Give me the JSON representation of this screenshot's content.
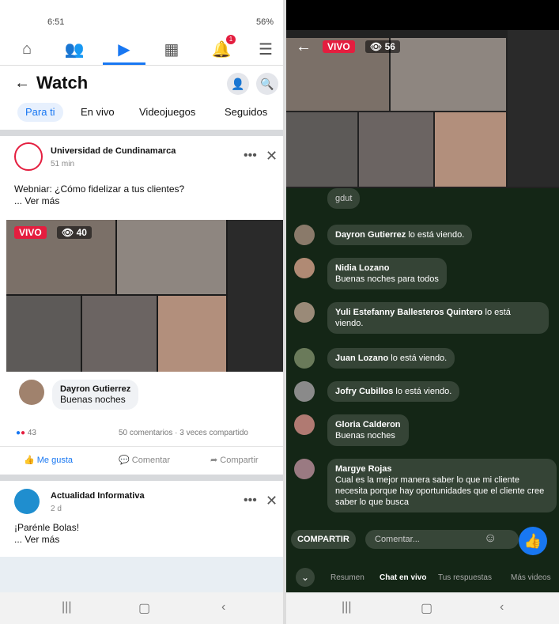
{
  "left": {
    "status": {
      "time": "6:51",
      "right": "56%"
    },
    "nav": {
      "icons": [
        "home-icon",
        "friends-icon",
        "watch-icon",
        "marketplace-icon",
        "notifications-icon",
        "menu-icon"
      ]
    },
    "header": {
      "title": "Watch"
    },
    "tabs": [
      {
        "label": "Para ti"
      },
      {
        "label": "En vivo"
      },
      {
        "label": "Videojuegos"
      },
      {
        "label": "Seguidos"
      }
    ],
    "post1": {
      "page": "Universidad de Cundinamarca",
      "meta": "51 min",
      "text": "Webniar: ¿Cómo fidelizar a tus clientes?",
      "see_more": "... Ver más",
      "live_label": "VIVO",
      "views": "40",
      "comment": {
        "name": "Dayron Gutierrez",
        "text": "Buenas noches"
      },
      "reactions_count": "43",
      "stats": "50 comentarios · 3 veces compartido",
      "actions": [
        "Me gusta",
        "Comentar",
        "Compartir"
      ]
    },
    "post2": {
      "page": "Actualidad Informativa",
      "meta": "2 d",
      "text": "¡Parénle Bolas!",
      "see_more": "... Ver más"
    }
  },
  "right": {
    "live_label": "VIVO",
    "views": "56",
    "partial_comment": "gdut",
    "chat": [
      {
        "name": "Dayron Gutierrez",
        "text": "lo está viendo."
      },
      {
        "name": "Nidia Lozano",
        "text": "Buenas noches  para todos"
      },
      {
        "name": "Yuli Estefanny Ballesteros Quintero",
        "text": "lo está viendo."
      },
      {
        "name": "Juan Lozano",
        "text": "lo está viendo."
      },
      {
        "name": "Jofry Cubillos",
        "text": "lo está viendo."
      },
      {
        "name": "Gloria Calderon",
        "text": "Buenas noches"
      },
      {
        "name": "Margye Rojas",
        "text": "Cual es la mejor manera  saber lo que mi cliente  necesita  porque hay oportunidades que el cliente cree saber  lo que busca"
      }
    ],
    "share_label": "COMPARTIR",
    "comment_placeholder": "Comentar...",
    "bottom_tabs": [
      "Resumen",
      "Chat en vivo",
      "Tus respuestas",
      "Más videos"
    ]
  }
}
